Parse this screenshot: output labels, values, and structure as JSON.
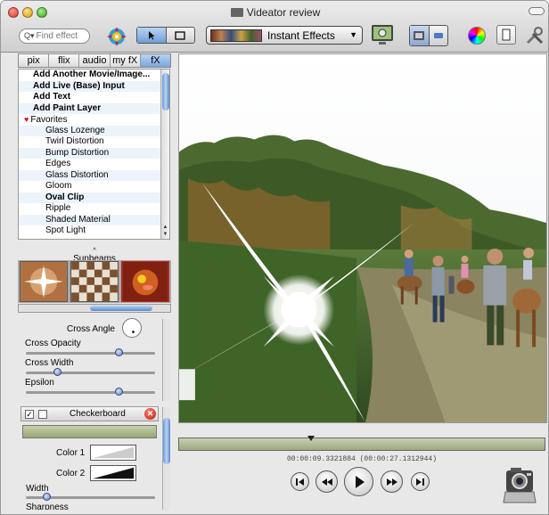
{
  "window": {
    "title": "Videator review"
  },
  "toolbar": {
    "search_placeholder": "Find effect",
    "effects_popup_label": "Instant Effects"
  },
  "tabs": [
    {
      "label": "pix",
      "active": false
    },
    {
      "label": "flix",
      "active": false
    },
    {
      "label": "audio",
      "active": false
    },
    {
      "label": "my fX",
      "active": false
    },
    {
      "label": "fX",
      "active": true
    }
  ],
  "effects_list": {
    "actions": [
      "Add Another Movie/Image...",
      "Add Live (Base) Input",
      "Add Text",
      "Add Paint Layer"
    ],
    "favorites_label": "Favorites",
    "items": [
      "Glass Lozenge",
      "Twirl Distortion",
      "Bump Distortion",
      "Edges",
      "Glass Distortion",
      "Gloom",
      "Oval Clip",
      "Ripple",
      "Shaded Material",
      "Spot Light"
    ]
  },
  "preview": {
    "label": "Sunbeams"
  },
  "params": {
    "cross_angle_label": "Cross Angle",
    "cross_opacity_label": "Cross Opacity",
    "cross_width_label": "Cross Width",
    "epsilon_label": "Epsilon",
    "cross_opacity_value": 0.72,
    "cross_width_value": 0.24,
    "epsilon_value": 0.72
  },
  "layer": {
    "name": "Checkerboard",
    "color1_label": "Color 1",
    "color2_label": "Color 2",
    "width_label": "Width",
    "sharpness_label": "Sharpness",
    "enabled": true,
    "width_value": 0.16
  },
  "playback": {
    "timecode": "00:00:09.3321884 (00:00:27.1312944)",
    "position": 0.36
  }
}
